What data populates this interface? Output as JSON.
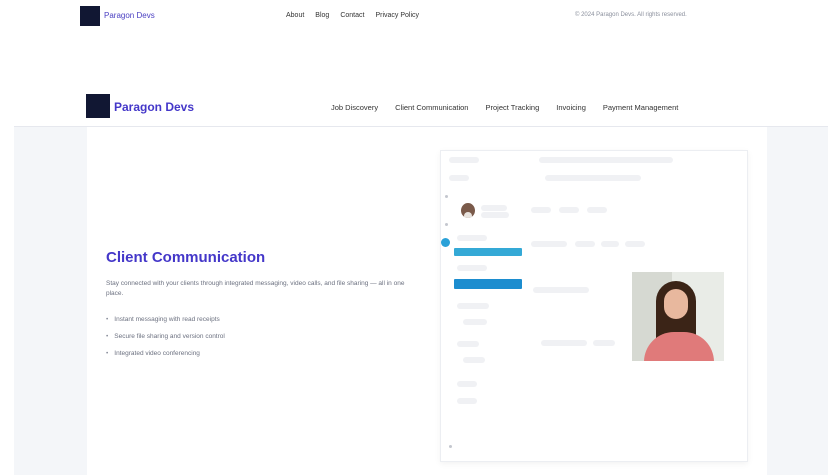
{
  "top_bar": {
    "brand": "Paragon Devs",
    "nav": [
      "About",
      "Blog",
      "Contact",
      "Privacy Policy"
    ],
    "copyright": "© 2024 Paragon Devs. All rights reserved."
  },
  "header": {
    "brand": "Paragon Devs",
    "nav": [
      "Job Discovery",
      "Client Communication",
      "Project Tracking",
      "Invoicing",
      "Payment Management"
    ]
  },
  "feature": {
    "title": "Client Communication",
    "description": "Stay connected with your clients through integrated messaging, video calls, and file sharing — all in one place.",
    "bullets": [
      "Instant messaging with read receipts",
      "Secure file sharing and version control",
      "Integrated video conferencing"
    ]
  },
  "colors": {
    "brand": "#4437c9",
    "logo": "#111733",
    "accent": "#2aa1d8"
  }
}
